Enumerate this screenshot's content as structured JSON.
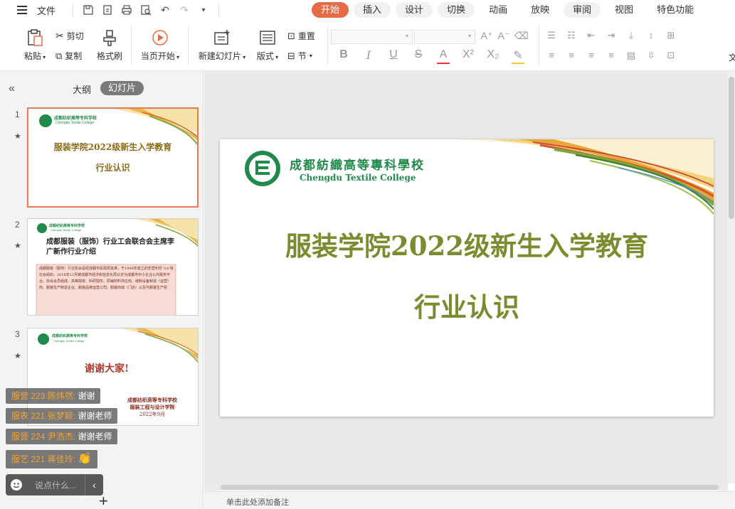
{
  "menubar": {
    "file_label": "文件",
    "tabs": [
      "开始",
      "插入",
      "设计",
      "切换",
      "动画",
      "放映",
      "审阅",
      "视图",
      "特色功能"
    ],
    "active_tab": "开始"
  },
  "ribbon": {
    "paste": "粘贴",
    "cut": "剪切",
    "copy": "复制",
    "format_painter": "格式刷",
    "from_current": "当页开始",
    "new_slide": "新建幻灯片",
    "layout": "版式",
    "reset": "重置",
    "section": "节",
    "more": "文"
  },
  "left_panel": {
    "outline_tab": "大纲",
    "slides_tab": "幻灯片",
    "thumbnails": [
      {
        "number": "1",
        "school": "成都纺织高等专科学校",
        "school_en": "Chengdu Textile College",
        "title": "服装学院2022级新生入学教育",
        "subtitle": "行业认识"
      },
      {
        "number": "2",
        "school": "成都纺织高等专科学校",
        "school_en": "Chengdu Textile College",
        "title": "成都服装（服饰）行业工会联合会主席李广新作行业介绍",
        "body": "成都服装（服饰）行业协会是经成都市民政局批准，于1989年成立的非营利性“5A”级社会组织。2018年12月被成都市经济和信息化局认定为成都市中小企业公共服务平台。协会会员组成：高等院校、科研院所、原辅材料供应商、缝制设备制造（运营）商、服装生产制造企业、服装品牌运营公司、服装商城（门店）以及与服装生产经"
      },
      {
        "number": "3",
        "school": "成都纺织高等专科学校",
        "school_en": "Chengdu Textile College",
        "title": "谢谢大家!",
        "footer1": "成都纺织高等专科学校",
        "footer2": "服装工程与设计学院",
        "footer3": "2022年9月"
      }
    ]
  },
  "slide": {
    "school_name": "成都紡織高等專科學校",
    "school_name_en": "Chengdu Textile College",
    "title": "服装学院2022级新生入学教育",
    "subtitle": "行业认识"
  },
  "notes": {
    "placeholder": "单击此处添加备注"
  },
  "chat": {
    "messages": [
      {
        "name": "服营 223 陈炜然: ",
        "text": "谢谢"
      },
      {
        "name": "服表 221 张梦颖: ",
        "text": "谢谢老师"
      },
      {
        "name": "服营 224 尹浩杰: ",
        "text": "谢谢老师"
      },
      {
        "name": "服艺 221 蒋佳玲: ",
        "text": "👏"
      }
    ],
    "input_placeholder": "说点什么..."
  },
  "colors": {
    "accent": "#e86b48",
    "title_green": "#7a8c2e",
    "logo_green": "#1f8a4a",
    "chat_name": "#f0a23a"
  }
}
